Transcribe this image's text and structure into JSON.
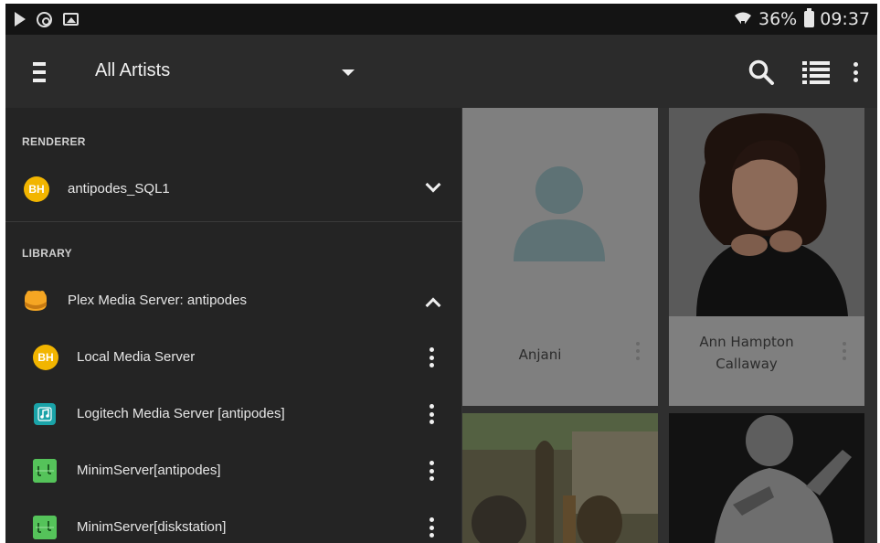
{
  "status_bar": {
    "battery": "36%",
    "time": "09:37"
  },
  "toolbar": {
    "title": "All Artists"
  },
  "drawer": {
    "renderer_header": "RENDERER",
    "renderer": {
      "label": "antipodes_SQL1",
      "icon_text": "BH"
    },
    "library_header": "LIBRARY",
    "library_items": [
      {
        "label": "Plex Media Server: antipodes",
        "icon": "plex-icon"
      },
      {
        "label": "Local Media Server",
        "icon": "bubbleupnp-icon",
        "icon_text": "BH"
      },
      {
        "label": "Logitech Media Server [antipodes]",
        "icon": "logitech-music-icon"
      },
      {
        "label": "MinimServer[antipodes]",
        "icon": "minim-icon"
      },
      {
        "label": "MinimServer[diskstation]",
        "icon": "minim-icon"
      }
    ]
  },
  "artists": [
    {
      "name": "Anjani"
    },
    {
      "name": "Ann Hampton Callaway"
    }
  ],
  "colors": {
    "toolbar": "#2b2b2b",
    "drawer": "#242424",
    "accent_yellow": "#f2b500",
    "minim_green": "#55c35a",
    "logitech_teal": "#1aa3a8"
  }
}
